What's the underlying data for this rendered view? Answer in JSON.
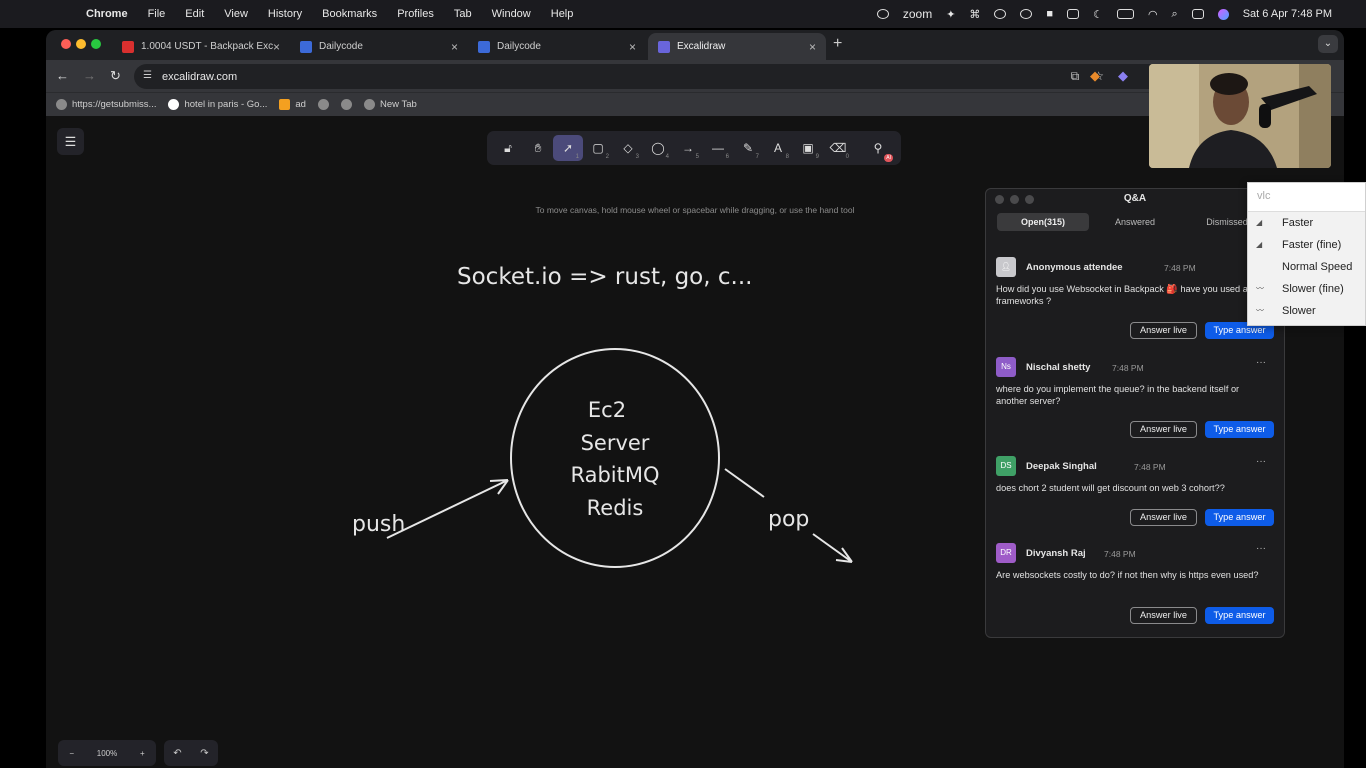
{
  "menubar": {
    "apple": "",
    "app": "Chrome",
    "items": [
      "File",
      "Edit",
      "View",
      "History",
      "Bookmarks",
      "Profiles",
      "Tab",
      "Window",
      "Help"
    ],
    "zoom_label": "zoom",
    "datetime": "Sat 6 Apr  7:48 PM"
  },
  "tabs": [
    {
      "title": "1.0004 USDT - Backpack Exc",
      "fav_color": "#d9302f"
    },
    {
      "title": "Dailycode",
      "fav_color": "#3c6ad8"
    },
    {
      "title": "Dailycode",
      "fav_color": "#3c6ad8"
    },
    {
      "title": "Excalidraw",
      "fav_color": "#6965db"
    }
  ],
  "address": {
    "url": "excalidraw.com"
  },
  "bookmarks": [
    "https://getsubmiss...",
    "hotel in paris - Go...",
    "ad",
    "",
    "",
    "New Tab"
  ],
  "excalidraw": {
    "hint": "To move canvas, hold mouse wheel or spacebar while dragging, or use the hand tool",
    "zoom": "100%",
    "tool_keys": [
      "",
      "",
      "1",
      "2",
      "3",
      "4",
      "5",
      "6",
      "7",
      "8",
      "9",
      "0",
      ""
    ],
    "ai_badge": "AI"
  },
  "drawing": {
    "heading": "Socket.io => rust, go, c...",
    "circle_lines": [
      "Ec2",
      "Server",
      "RabitMQ",
      "Redis"
    ],
    "left_label": "push",
    "right_label": "pop"
  },
  "qa": {
    "title": "Q&A",
    "tabs": [
      "Open(315)",
      "Answered",
      "Dismissed"
    ],
    "answer_live": "Answer live",
    "type_answer": "Type answer",
    "questions": [
      {
        "initials": "",
        "name": "Anonymous attendee",
        "time": "7:48 PM",
        "text": "How did you use Websocket in Backpack 🎒 have you used any frameworks ?",
        "color": "#c8c8cc"
      },
      {
        "initials": "Ns",
        "name": "Nischal shetty",
        "time": "7:48 PM",
        "text": "where do you implement the queue? in the backend itself or another server?",
        "color": "#8e5cc8"
      },
      {
        "initials": "DS",
        "name": "Deepak Singhal",
        "time": "7:48 PM",
        "text": "does chort 2 student will get discount on web 3 cohort??",
        "color": "#3fa066"
      },
      {
        "initials": "DR",
        "name": "Divyansh Raj",
        "time": "7:48 PM",
        "text": "Are websockets costly to do? if not then why is https even used?",
        "color": "#9f5cc8"
      }
    ]
  },
  "vlc": {
    "placeholder": "vlc",
    "items": [
      "Faster",
      "Faster (fine)",
      "Normal Speed",
      "Slower (fine)",
      "Slower"
    ]
  }
}
